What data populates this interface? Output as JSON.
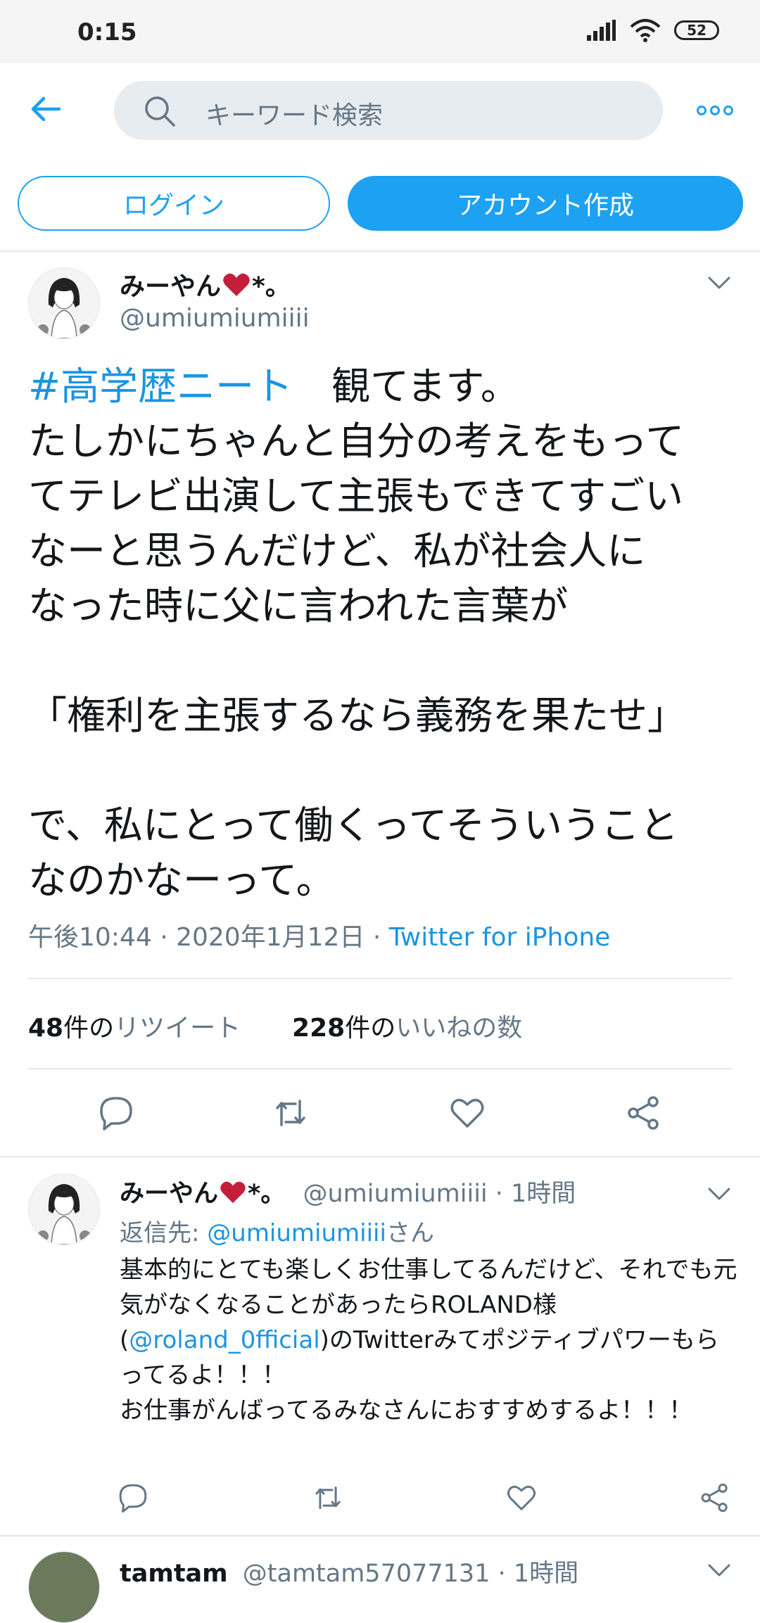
{
  "status_bar": {
    "time": "0:15",
    "battery": "52"
  },
  "header": {
    "search_placeholder": "キーワード検索"
  },
  "buttons": {
    "login": "ログイン",
    "signup": "アカウント作成"
  },
  "tweet": {
    "author_name": "みーやん",
    "author_suffix": "*。",
    "author_handle": "@umiumiumiiii",
    "hashtag": "#高学歴ニート",
    "body_after_hashtag": "　観てます。\nたしかにちゃんと自分の考えをもって\nてテレビ出演して主張もできてすごい\nなーと思うんだけど、私が社会人に\nなった時に父に言われた言葉が\n\n「権利を主張するなら義務を果たせ」\n\nで、私にとって働くってそういうこと\nなのかなーって。",
    "timestamp": "午後10:44 · 2020年1月12日 · ",
    "source": "Twitter for iPhone",
    "retweets_count": "48",
    "retweets_unit": "件の",
    "retweets_label": "リツイート",
    "likes_count": "228",
    "likes_unit": "件の",
    "likes_label": "いいねの数"
  },
  "reply": {
    "author_name": "みーやん",
    "author_suffix": "*。",
    "author_handle": "@umiumiumiiii",
    "time": " · 1時間",
    "reply_to_label": "返信先: ",
    "reply_to_handle": "@umiumiumiiii",
    "reply_to_suffix": "さん",
    "text_1": "基本的にとても楽しくお仕事してるんだけど、それでも元気がなくなることがあったらROLAND様(",
    "mention": "@roland_0fficial",
    "text_2": ")のTwitterみてポジティブパワーもらってるよ！！！\nお仕事がんばってるみなさんにおすすめするよ！！！"
  },
  "next_reply": {
    "author_name": "tamtam",
    "author_handle": "@tamtam57077131",
    "time": " · 1時間"
  },
  "colors": {
    "accent": "#1da1f2",
    "heart": "#e0245e",
    "secondary": "#657786"
  }
}
